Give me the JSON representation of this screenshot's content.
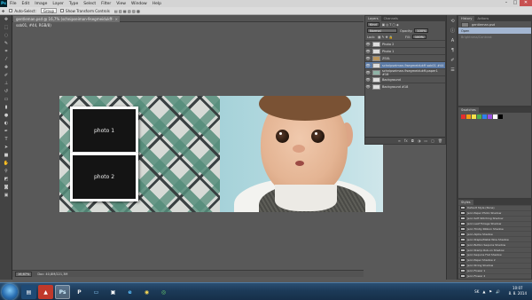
{
  "app": {
    "logo": "Ps"
  },
  "menu": [
    "File",
    "Edit",
    "Image",
    "Layer",
    "Type",
    "Select",
    "Filter",
    "View",
    "Window",
    "Help"
  ],
  "window_controls": {
    "minimize": "–",
    "maximize": "□",
    "close": "✕"
  },
  "options_bar": {
    "auto_select_label": "Auto-Select:",
    "auto_select_value": "Group",
    "transform_label": "Show Transform Controls",
    "workspace": "DesignCS7"
  },
  "document": {
    "tab_title": "gentleman.psd @ 16,7% (schnipseiman-9segmeidukff-sob01, #44, RGB/8)",
    "tab_close": "×"
  },
  "canvas": {
    "frame_top_label": "photo 1",
    "frame_bottom_label": "photo 2"
  },
  "layers_panel": {
    "tabs": [
      "Layers",
      "Channels"
    ],
    "kind_label": "Kind",
    "blend_mode": "Normal",
    "opacity_label": "Opacity:",
    "opacity": "100%",
    "lock_label": "Lock:",
    "fill_label": "Fill:",
    "fill": "100%",
    "layers": [
      {
        "name": "Photo 2"
      },
      {
        "name": "Photo 1"
      },
      {
        "name": "ZSXL"
      },
      {
        "name": "schnipseiman-9segmeidukff sob01 #44"
      },
      {
        "name": "schnipseiman-9segmeidukff-paper1 #18"
      },
      {
        "name": "Background"
      },
      {
        "name": "Background #18"
      }
    ],
    "footer_icons": [
      "link",
      "fx",
      "mask",
      "adjust",
      "folder",
      "new",
      "trash"
    ]
  },
  "history_panel": {
    "tabs": [
      "History",
      "Actions"
    ],
    "items": [
      {
        "label": "gentleman.psd"
      },
      {
        "label": "Open"
      },
      {
        "label": "Brightness/Contrast"
      }
    ]
  },
  "swatches_panel": {
    "title": "Swatches",
    "colors": [
      "#e52d2d",
      "#f39c12",
      "#f5e14a",
      "#4caf50",
      "#2f80ed",
      "#9b51e0",
      "#ffffff",
      "#000000"
    ]
  },
  "styles_panel": {
    "title": "Styles",
    "items": [
      "Default Style (None)",
      "Jenn Paper Photo Shadow",
      "Jenn Soft Stitching Shadow",
      "Jenn Leaf Foliage Shadow",
      "Jenn Trinity Ribbon Shadow",
      "Jenn Alpha Shadow",
      "Jenn Staple/Metal Wire Shadow",
      "Jenn Button Sequins Shadow",
      "Jenn Stamp Rub-on Shadow",
      "Jenn Sequins Flat Shadow",
      "Jenn Paper Shadow 2",
      "Jenn String Shadow",
      "Jenn Flower 1",
      "Jenn Flower 2"
    ]
  },
  "status_bar": {
    "zoom": "16,67%",
    "doc": "Doc: 40,8M/221,3M"
  },
  "taskbar": {
    "tray": [
      "SK",
      "▲",
      "⚑",
      "🔊"
    ],
    "time": "10:07",
    "date": "8. 8. 2014"
  }
}
